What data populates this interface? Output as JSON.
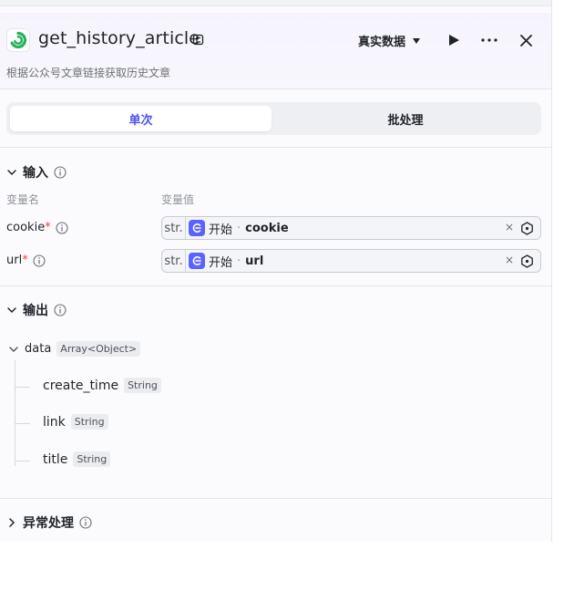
{
  "header": {
    "title": "get_history_article",
    "description": "根据公众号文章链接获取历史文章",
    "data_select_label": "真实数据",
    "brand_color": "#27b25f"
  },
  "tabs": [
    {
      "label": "单次",
      "active": true
    },
    {
      "label": "批处理",
      "active": false
    }
  ],
  "input_section": {
    "title": "输入",
    "col_name": "变量名",
    "col_value": "变量值",
    "rows": [
      {
        "name": "cookie",
        "required_mark": "*",
        "type": "str.",
        "source": "开始",
        "separator": "·",
        "var": "cookie",
        "clear": "×"
      },
      {
        "name": "url",
        "required_mark": "*",
        "type": "str.",
        "source": "开始",
        "separator": "·",
        "var": "url",
        "clear": "×"
      }
    ]
  },
  "output_section": {
    "title": "输出",
    "root": {
      "name": "data",
      "type": "Array<Object>"
    },
    "children": [
      {
        "name": "create_time",
        "type": "String"
      },
      {
        "name": "link",
        "type": "String"
      },
      {
        "name": "title",
        "type": "String"
      }
    ]
  },
  "exception_section": {
    "title": "异常处理"
  }
}
